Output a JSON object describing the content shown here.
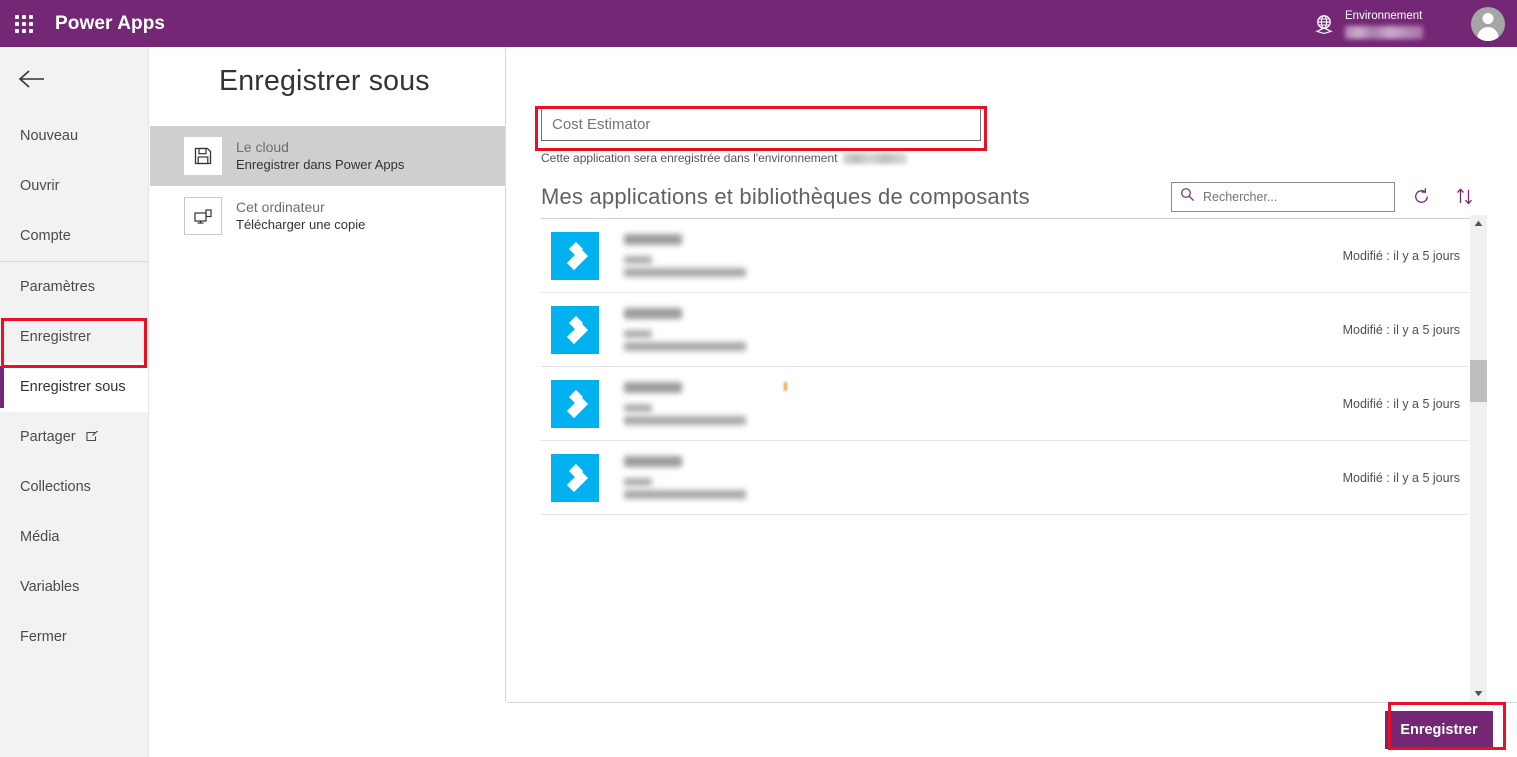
{
  "header": {
    "waffle_icon": "waffle-menu-icon",
    "brand": "Power Apps",
    "environment_icon": "globe-environment-icon",
    "environment_label": "Environnement",
    "environment_value": "",
    "avatar_icon": "user-avatar-icon"
  },
  "sidebar": {
    "back_icon": "back-arrow-icon",
    "items": [
      {
        "label": "Nouveau",
        "active": false
      },
      {
        "label": "Ouvrir",
        "active": false
      },
      {
        "label": "Compte",
        "active": false
      },
      {
        "label": "Paramètres",
        "active": false
      },
      {
        "label": "Enregistrer",
        "active": false
      },
      {
        "label": "Enregistrer sous",
        "active": true
      },
      {
        "label": "Partager",
        "active": false,
        "icon": "external-link-icon"
      },
      {
        "label": "Collections",
        "active": false
      },
      {
        "label": "Média",
        "active": false
      },
      {
        "label": "Variables",
        "active": false
      },
      {
        "label": "Fermer",
        "active": false
      }
    ]
  },
  "middle": {
    "page_title": "Enregistrer sous",
    "destinations": [
      {
        "icon": "floppy-disk-save-icon",
        "title": "Le cloud",
        "subtitle": "Enregistrer dans Power Apps",
        "selected": true
      },
      {
        "icon": "computer-download-icon",
        "title": "Cet ordinateur",
        "subtitle": "Télécharger une copie",
        "selected": false
      }
    ]
  },
  "main": {
    "app_name_value": "Cost Estimator",
    "app_name_placeholder": "Cost Estimator",
    "environment_note": "Cette application sera enregistrée dans l'environnement",
    "section_title": "Mes applications et bibliothèques de composants",
    "search": {
      "icon": "search-icon",
      "placeholder": "Rechercher...",
      "value": ""
    },
    "refresh_icon": "refresh-icon",
    "sort_icon": "sort-ascending-descending-icon",
    "app_rows": [
      {
        "logo": "powerapps-app-tile-icon",
        "modified": "Modifié : il y a 5 jours"
      },
      {
        "logo": "powerapps-app-tile-icon",
        "modified": "Modifié : il y a 5 jours"
      },
      {
        "logo": "powerapps-app-tile-icon",
        "modified": "Modifié : il y a 5 jours"
      },
      {
        "logo": "powerapps-app-tile-icon",
        "modified": "Modifié : il y a 5 jours"
      }
    ],
    "scrollbar": {
      "up_icon": "scroll-up-arrow-icon",
      "down_icon": "scroll-down-arrow-icon"
    }
  },
  "footer": {
    "save_label": "Enregistrer"
  },
  "colors": {
    "brand_purple": "#742774",
    "annotation_red": "#e81123",
    "app_tile_blue": "#00b1f0",
    "sidebar_bg": "#f2f2f2",
    "selected_dest_bg": "#cfcfcf"
  }
}
